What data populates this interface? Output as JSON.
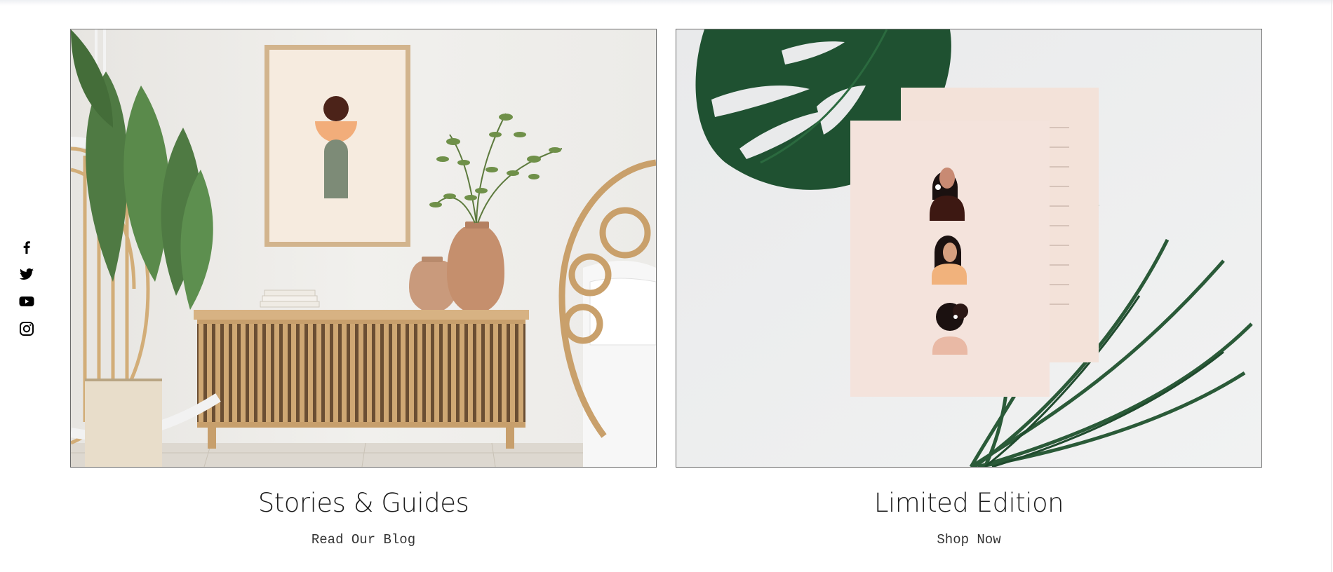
{
  "social": [
    {
      "name": "facebook",
      "icon": "facebook-icon"
    },
    {
      "name": "twitter",
      "icon": "twitter-icon"
    },
    {
      "name": "youtube",
      "icon": "youtube-icon"
    },
    {
      "name": "instagram",
      "icon": "instagram-icon"
    }
  ],
  "cards": [
    {
      "title": "Stories & Guides",
      "link_label": "Read Our Blog",
      "image": "living-room-sideboard-photo"
    },
    {
      "title": "Limited Edition",
      "link_label": "Shop Now",
      "image": "art-cards-with-palm-leaves-photo"
    }
  ],
  "colors": {
    "text": "#1d1d1d",
    "link": "#333333",
    "border": "#6b6b6b",
    "background": "#ffffff"
  }
}
